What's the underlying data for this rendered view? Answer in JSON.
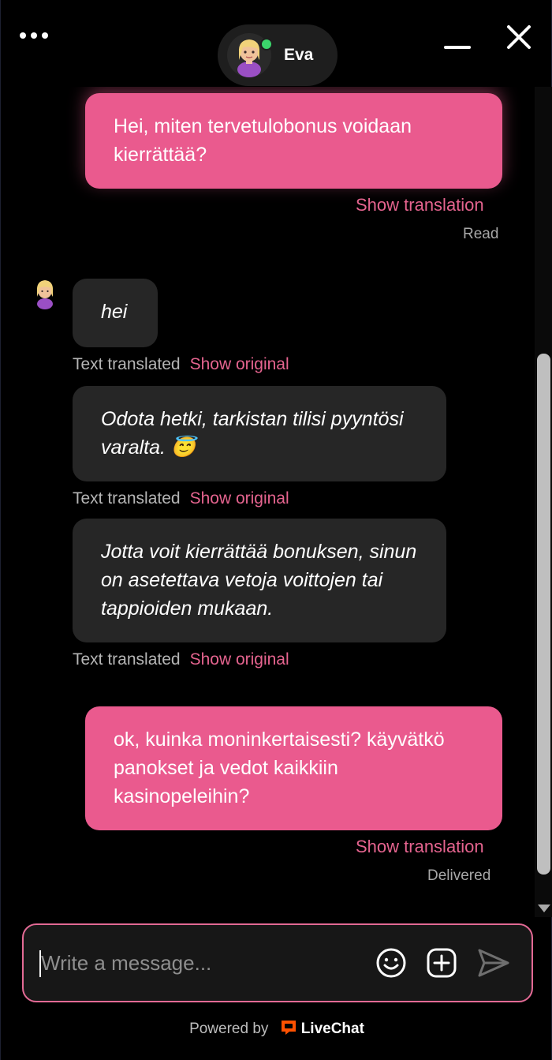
{
  "header": {
    "agent_name": "Eva",
    "icons": {
      "menu": "ellipsis-icon",
      "minimize": "minimize-icon",
      "close": "close-icon"
    }
  },
  "messages": [
    {
      "from": "visitor",
      "text": "Hei, miten tervetulobonus voidaan kierrättää?",
      "show_translation": "Show translation",
      "status": "Read"
    },
    {
      "from": "agent",
      "text": "hei",
      "translated_label": "Text translated",
      "show_original": "Show original"
    },
    {
      "from": "agent",
      "text": "Odota hetki, tarkistan tilisi pyyntösi varalta. 😇",
      "translated_label": "Text translated",
      "show_original": "Show original"
    },
    {
      "from": "agent",
      "text": "Jotta voit kierrättää bonuksen, sinun on asetettava vetoja voittojen tai tappioiden mukaan.",
      "translated_label": "Text translated",
      "show_original": "Show original"
    },
    {
      "from": "visitor",
      "text": "ok, kuinka moninkertaisesti? käyvätkö panokset ja vedot kaikkiin kasinopeleihin?",
      "show_translation": "Show translation",
      "status": "Delivered"
    }
  ],
  "composer": {
    "placeholder": "Write a message...",
    "icons": {
      "emoji": "emoji-icon",
      "attach": "add-attachment-icon",
      "send": "send-icon"
    }
  },
  "footer": {
    "powered_by": "Powered by",
    "brand": "LiveChat"
  },
  "colors": {
    "accent": "#ea5a8e",
    "agent_bubble": "#262626",
    "background": "#000000",
    "online": "#3bd46b"
  }
}
